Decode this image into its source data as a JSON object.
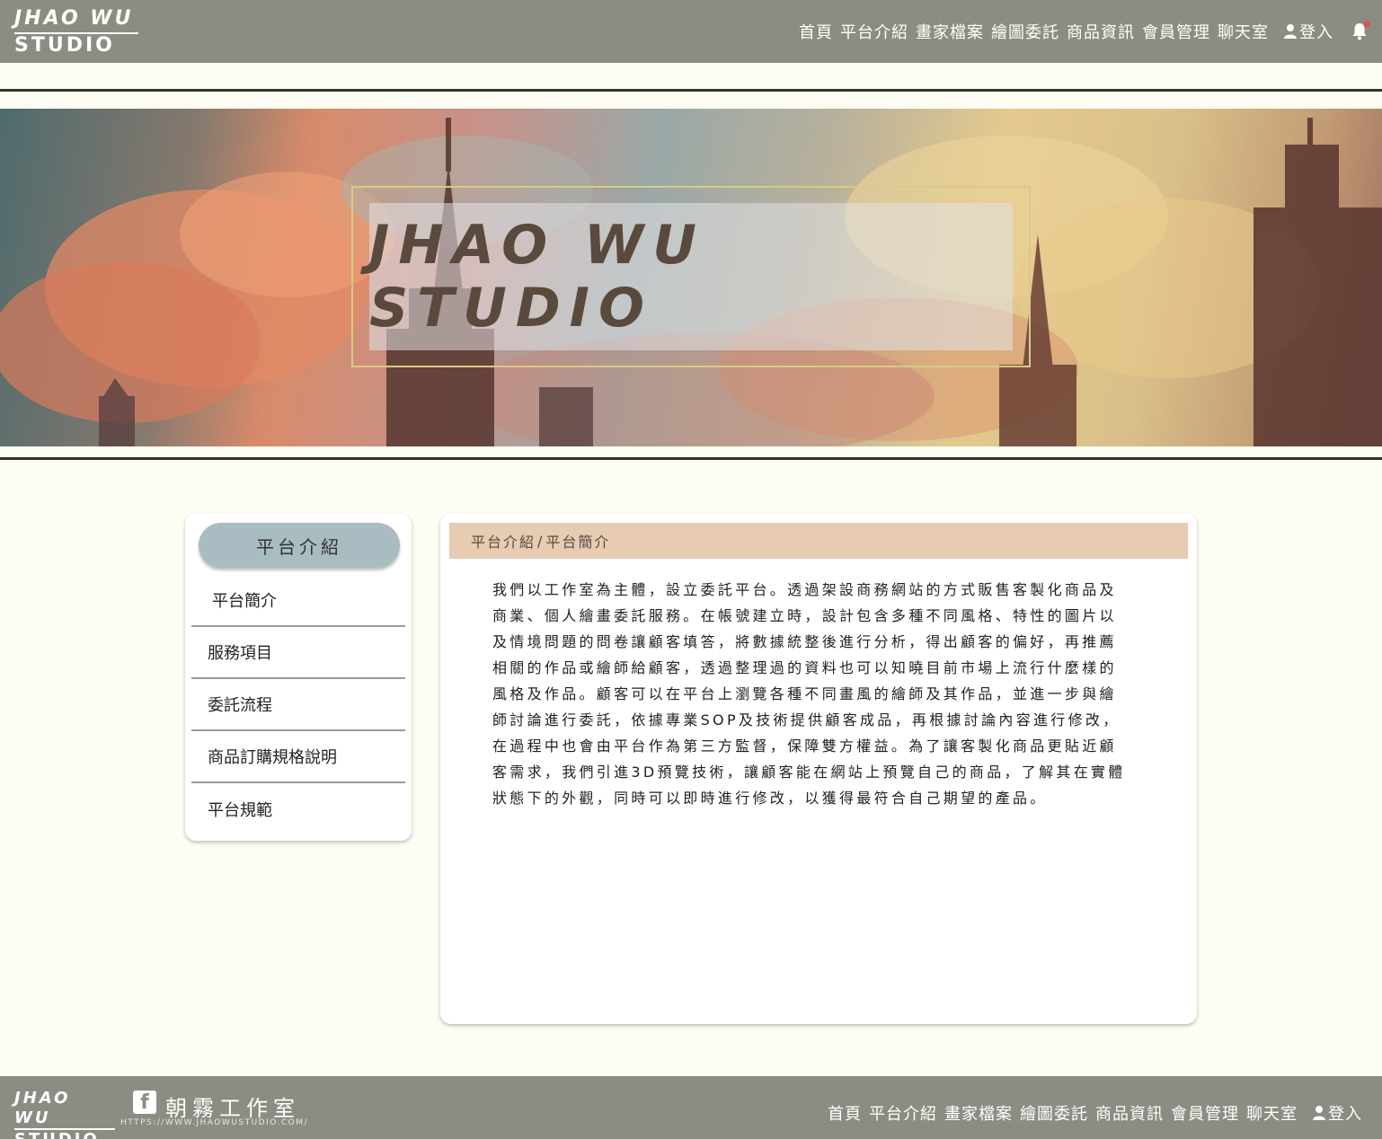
{
  "header": {
    "logo_line1": "JHAO WU",
    "logo_line2": "STUDIO",
    "nav": [
      "首頁",
      "平台介紹",
      "畫家檔案",
      "繪圖委託",
      "商品資訊",
      "會員管理",
      "聊天室"
    ],
    "login_label": "登入",
    "icons": [
      "user-icon",
      "bell-icon"
    ]
  },
  "banner": {
    "title": "JHAO WU STUDIO"
  },
  "sidebar": {
    "heading": "平台介紹",
    "items": [
      "平台簡介",
      "服務項目",
      "委託流程",
      "商品訂購規格說明",
      "平台規範"
    ]
  },
  "content": {
    "breadcrumb": [
      "平台介紹",
      "平台簡介"
    ],
    "breadcrumb_sep": "/",
    "lines": [
      "我們以工作室為主體，設立委託平台。透過架設商務網站的方式販售客製化商品及",
      "商業、個人繪畫委託服務。在帳號建立時，設計包含多種不同風格、特性的圖片以",
      "及情境問題的問卷讓顧客填答，將數據統整後進行分析，得出顧客的偏好，再推薦",
      "相關的作品或繪師給顧客，透過整理過的資料也可以知曉目前市場上流行什麼樣的",
      "風格及作品。顧客可以在平台上瀏覽各種不同畫風的繪師及其作品，並進一步與繪",
      "師討論進行委託，依據專業SOP及技術提供顧客成品，再根據討論內容進行修改，",
      "在過程中也會由平台作為第三方監督，保障雙方權益。為了讓客製化商品更貼近顧",
      "客需求，我們引進3D預覽技術，讓顧客能在網站上預覽自己的商品，了解其在實體",
      "狀態下的外觀，同時可以即時進行修改，以獲得最符合自己期望的產品。"
    ]
  },
  "footer": {
    "logo_line1": "JHAO WU",
    "logo_line2": "STUDIO",
    "studio_name": "朝霧工作室",
    "url": "HTTPS://WWW.JHAOWUSTUDIO.COM/",
    "nav": [
      "首頁",
      "平台介紹",
      "畫家檔案",
      "繪圖委託",
      "商品資訊",
      "會員管理",
      "聊天室"
    ],
    "login_label": "登入",
    "icons": [
      "facebook-icon",
      "user-icon"
    ]
  },
  "colors": {
    "header_bg": "#8c8c83",
    "page_bg": "#fdfdf3",
    "sidebar_heading_bg": "#a9bcc1",
    "breadcrumb_bg": "#e7cbb2",
    "banner_title": "#5a4a3e"
  }
}
